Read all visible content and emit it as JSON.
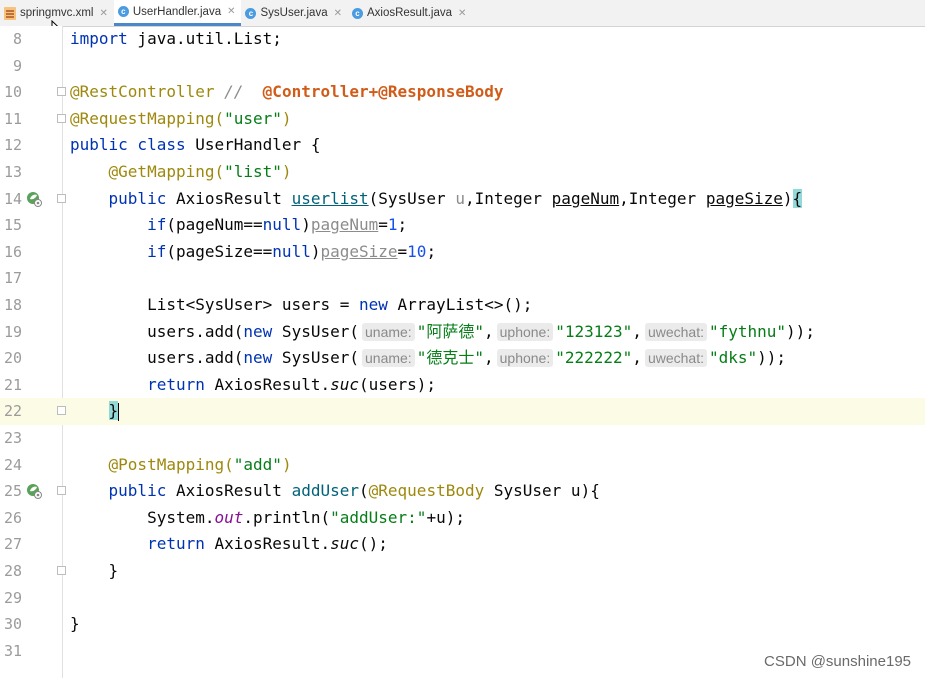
{
  "tabs": [
    {
      "label": "springmvc.xml",
      "icon": "xml-file-icon",
      "active": false
    },
    {
      "label": "UserHandler.java",
      "icon": "java-class-icon",
      "active": true
    },
    {
      "label": "SysUser.java",
      "icon": "java-class-icon",
      "active": false
    },
    {
      "label": "AxiosResult.java",
      "icon": "java-class-icon",
      "active": false
    }
  ],
  "line_numbers": [
    "8",
    "9",
    "10",
    "11",
    "12",
    "13",
    "14",
    "15",
    "16",
    "17",
    "18",
    "19",
    "20",
    "21",
    "22",
    "23",
    "24",
    "25",
    "26",
    "27",
    "28",
    "29",
    "30",
    "31"
  ],
  "code": {
    "l8": [
      "import",
      " java.util.List;"
    ],
    "l10": [
      "@RestController",
      " //  ",
      "@Controller+@ResponseBody"
    ],
    "l11": [
      "@RequestMapping(",
      "\"user\"",
      ")"
    ],
    "l12": [
      "public class",
      " UserHandler {"
    ],
    "l13": [
      "    @GetMapping(",
      "\"list\"",
      ")"
    ],
    "l14": [
      "    ",
      "public",
      " AxiosResult ",
      "userlist",
      "(SysUser ",
      "u",
      ",Integer ",
      "pageNum",
      ",Integer ",
      "pageSize",
      ")",
      "{"
    ],
    "l15": [
      "        ",
      "if",
      "(pageNum==",
      "null",
      ")",
      "pageNum",
      "=",
      "1",
      ";"
    ],
    "l16": [
      "        ",
      "if",
      "(pageSize==",
      "null",
      ")",
      "pageSize",
      "=",
      "10",
      ";"
    ],
    "l18": [
      "        List<SysUser> users = ",
      "new",
      " ArrayList<>();"
    ],
    "l19": [
      "        users.add(",
      "new",
      " SysUser(",
      "uname:",
      "\"阿萨德\"",
      ",",
      "uphone:",
      "\"123123\"",
      ",",
      "uwechat:",
      "\"fythnu\"",
      "));"
    ],
    "l20": [
      "        users.add(",
      "new",
      " SysUser(",
      "uname:",
      "\"德克士\"",
      ",",
      "uphone:",
      "\"222222\"",
      ",",
      "uwechat:",
      "\"dks\"",
      "));"
    ],
    "l21": [
      "        ",
      "return",
      " AxiosResult.",
      "suc",
      "(users);"
    ],
    "l22": [
      "    ",
      "}"
    ],
    "l24": [
      "    @PostMapping(",
      "\"add\"",
      ")"
    ],
    "l25": [
      "    ",
      "public",
      " AxiosResult ",
      "addUser",
      "(",
      "@RequestBody",
      " SysUser u){"
    ],
    "l26": [
      "        System.",
      "out",
      ".println(",
      "\"addUser:\"",
      "+u);"
    ],
    "l27": [
      "        ",
      "return",
      " AxiosResult.",
      "suc",
      "();"
    ],
    "l28": [
      "    }"
    ],
    "l30": [
      "}"
    ]
  },
  "watermark": "CSDN @sunshine195",
  "colors": {
    "keyword": "#0033b3",
    "annotation": "#9e880d",
    "string": "#067d17",
    "number": "#1750eb",
    "method": "#00627a",
    "current_line": "#fcfbe6",
    "brace_match": "#93d9d9"
  }
}
